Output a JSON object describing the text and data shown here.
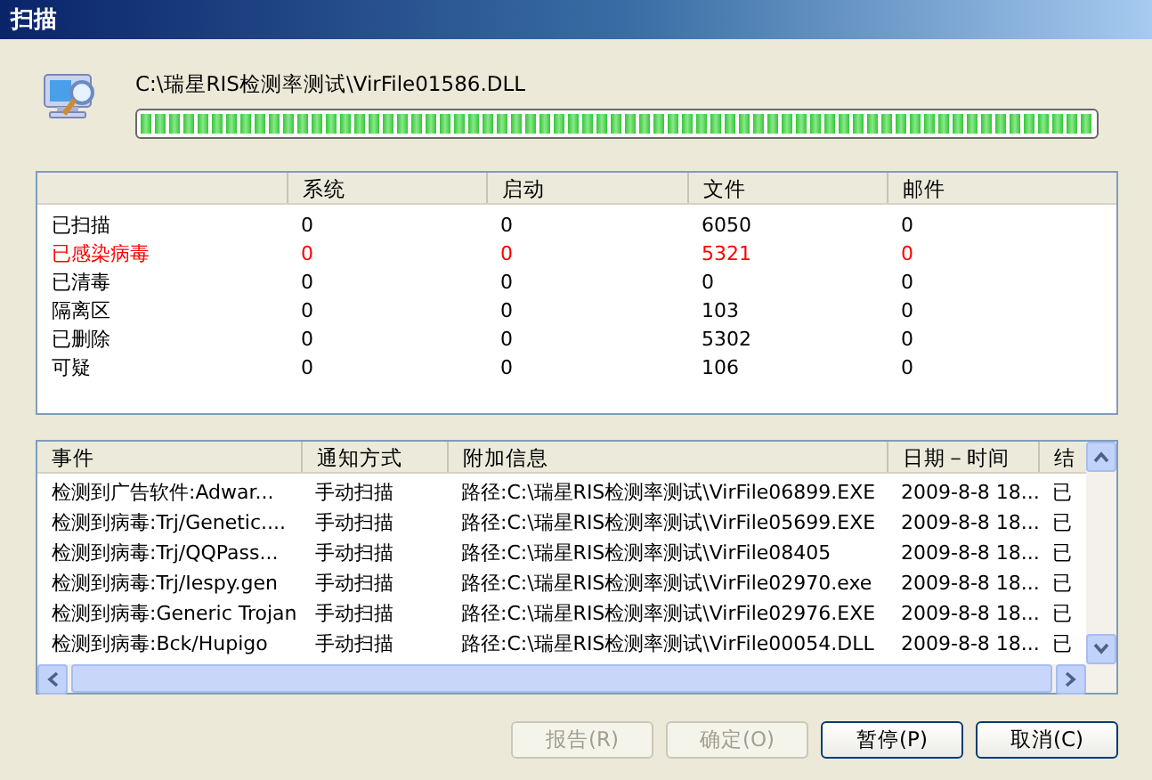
{
  "window": {
    "title": "扫描"
  },
  "scan": {
    "current_file": "C:\\瑞星RIS检测率测试\\VirFile01586.DLL",
    "level": 1
  },
  "stats": {
    "columns": [
      "系统",
      "启动",
      "文件",
      "邮件"
    ],
    "rows": [
      {
        "label": "已扫描",
        "alert": false,
        "values": [
          "0",
          "0",
          "6050",
          "0"
        ]
      },
      {
        "label": "已感染病毒",
        "alert": true,
        "values": [
          "0",
          "0",
          "5321",
          "0"
        ]
      },
      {
        "label": "已清毒",
        "alert": false,
        "values": [
          "0",
          "0",
          "0",
          "0"
        ]
      },
      {
        "label": "隔离区",
        "alert": false,
        "values": [
          "0",
          "0",
          "103",
          "0"
        ]
      },
      {
        "label": "已删除",
        "alert": false,
        "values": [
          "0",
          "0",
          "5302",
          "0"
        ]
      },
      {
        "label": "可疑",
        "alert": false,
        "values": [
          "0",
          "0",
          "106",
          "0"
        ]
      }
    ]
  },
  "events": {
    "columns": [
      "事件",
      "通知方式",
      "附加信息",
      "日期－时间",
      "结"
    ],
    "rows": [
      [
        "检测到广告软件:Adwar...",
        "手动扫描",
        "路径:C:\\瑞星RIS检测率测试\\VirFile06899.EXE",
        "2009-8-8 18...",
        "已"
      ],
      [
        "检测到病毒:Trj/Genetic....",
        "手动扫描",
        "路径:C:\\瑞星RIS检测率测试\\VirFile05699.EXE",
        "2009-8-8 18...",
        "已"
      ],
      [
        "检测到病毒:Trj/QQPass...",
        "手动扫描",
        "路径:C:\\瑞星RIS检测率测试\\VirFile08405",
        "2009-8-8 18...",
        "已"
      ],
      [
        "检测到病毒:Trj/Iespy.gen",
        "手动扫描",
        "路径:C:\\瑞星RIS检测率测试\\VirFile02970.exe",
        "2009-8-8 18...",
        "已"
      ],
      [
        "检测到病毒:Generic Trojan",
        "手动扫描",
        "路径:C:\\瑞星RIS检测率测试\\VirFile02976.EXE",
        "2009-8-8 18...",
        "已"
      ],
      [
        "检测到病毒:Bck/Hupigo",
        "手动扫描",
        "路径:C:\\瑞星RIS检测率测试\\VirFile00054.DLL",
        "2009-8-8 18...",
        "已"
      ]
    ]
  },
  "buttons": [
    {
      "label": "报告(R)",
      "disabled": true
    },
    {
      "label": "确定(O)",
      "disabled": true
    },
    {
      "label": "暂停(P)",
      "disabled": false
    },
    {
      "label": "取消(C)",
      "disabled": false
    }
  ]
}
